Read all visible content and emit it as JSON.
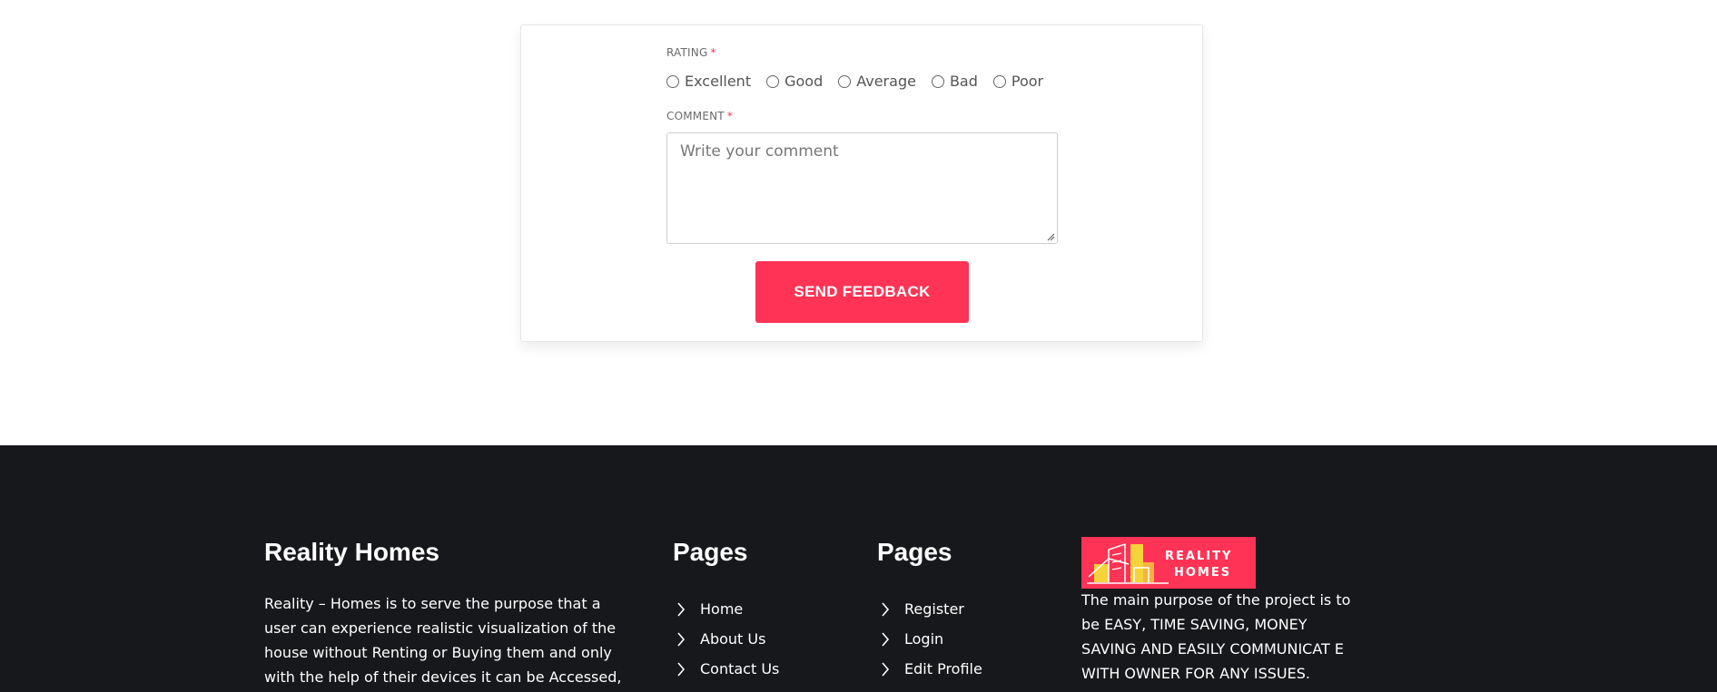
{
  "feedback_form": {
    "rating_label": "RATING",
    "required_mark": "*",
    "rating_options": [
      "Excellent",
      "Good",
      "Average",
      "Bad",
      "Poor"
    ],
    "comment_label": "COMMENT",
    "comment_placeholder": "Write your comment",
    "comment_value": "",
    "submit_label": "SEND FEEDBACK"
  },
  "footer": {
    "about": {
      "title": "Reality Homes",
      "text": "Reality – Homes is to serve the purpose that a user can experience realistic visualization of the house without Renting or Buying them and only with the help of their devices it can be Accessed, Anytime,"
    },
    "pages_1": {
      "title": "Pages",
      "links": [
        "Home",
        "About Us",
        "Contact Us"
      ]
    },
    "pages_2": {
      "title": "Pages",
      "links": [
        "Register",
        "Login",
        "Edit Profile"
      ]
    },
    "logo": {
      "line1": "REALITY",
      "line2": "HOMES"
    },
    "purpose_text": "The main purpose of the project is to be EASY, TIME SAVING, MONEY SAVING AND EASILY COMMUNICAT E WITH OWNER FOR ANY ISSUES."
  },
  "colors": {
    "accent": "#ff3355",
    "footer_bg": "#17181b",
    "text_muted": "#6b6b6b"
  },
  "icons": {
    "link_icon": "chevron-right-icon",
    "radio_icon": "radio-circle-icon",
    "resize_icon": "resize-grip-icon"
  }
}
